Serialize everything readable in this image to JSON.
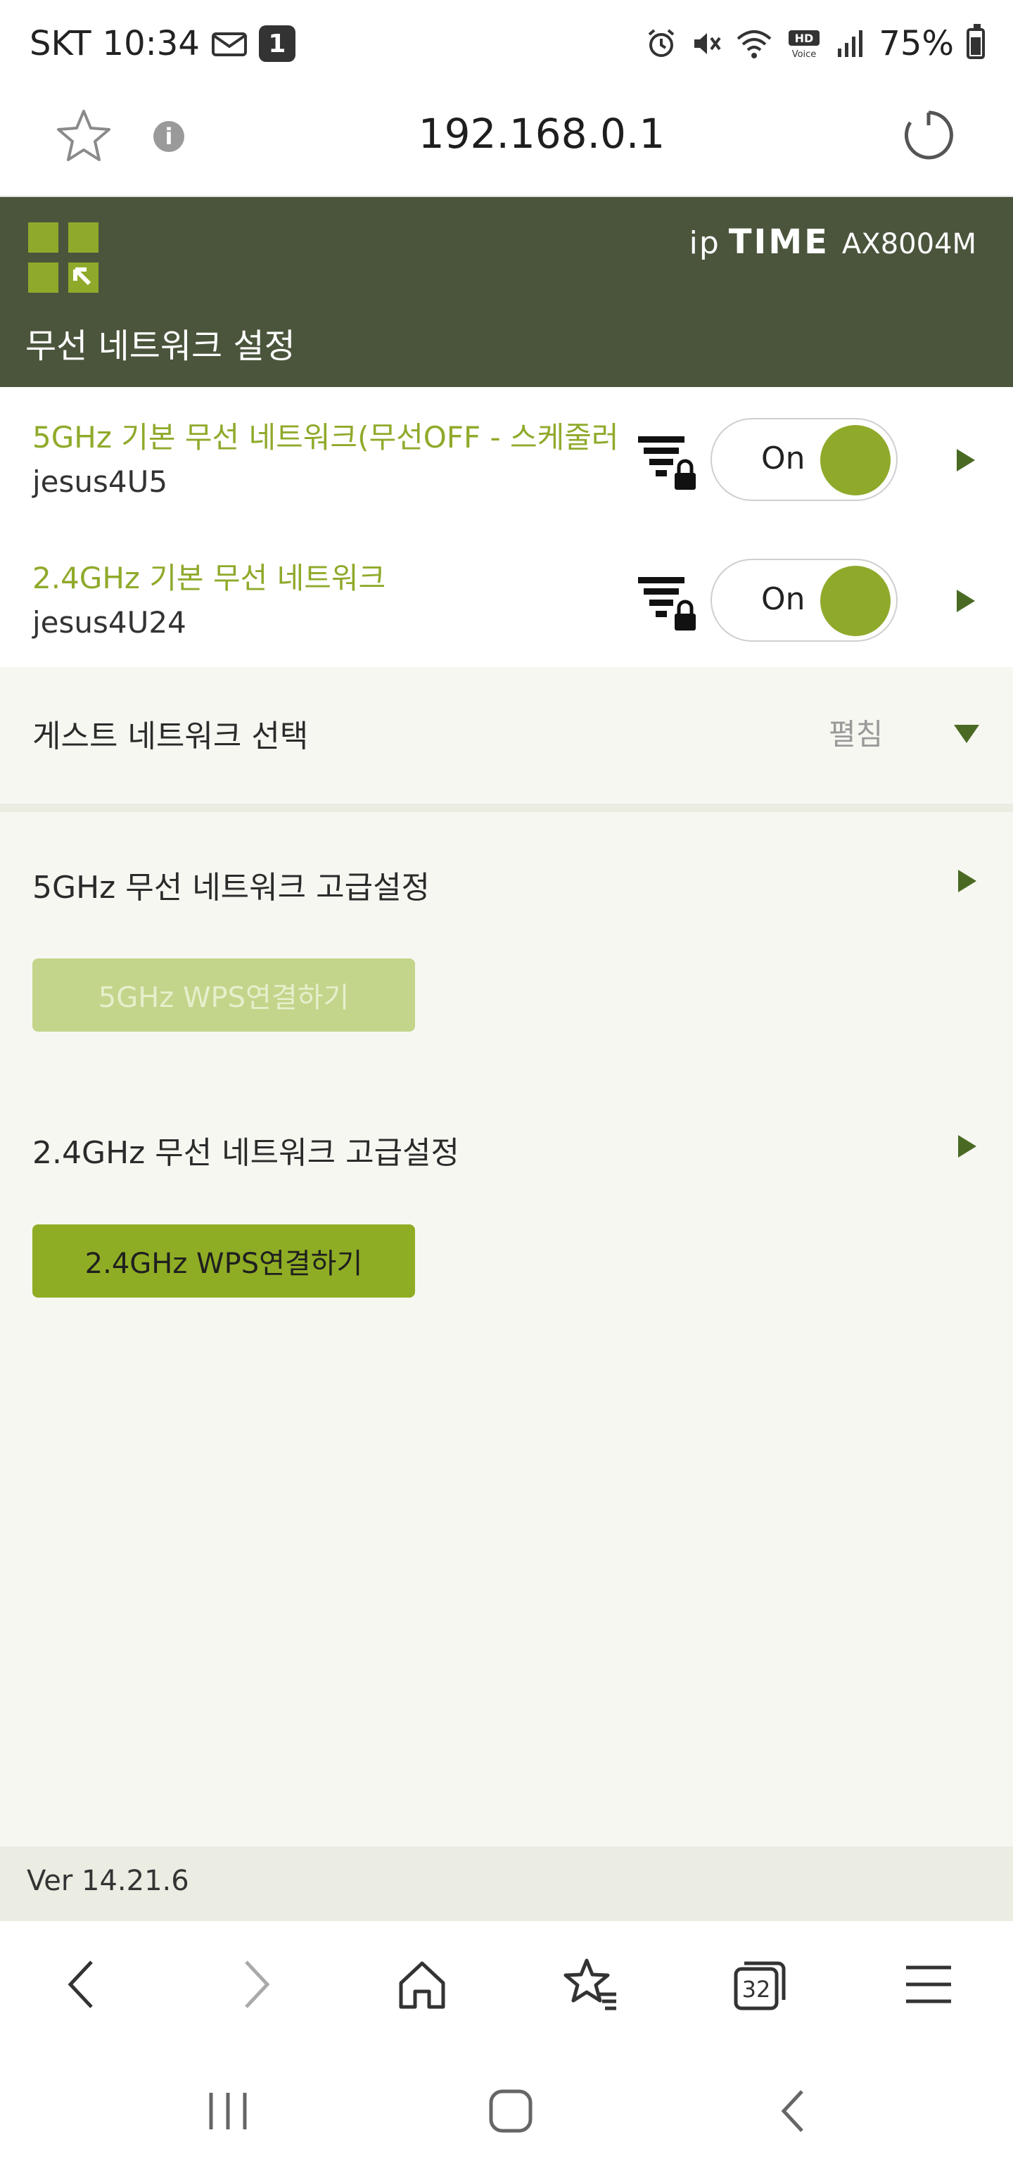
{
  "status_bar": {
    "carrier": "SKT",
    "time": "10:34",
    "notification_count": "1",
    "battery": "75%"
  },
  "url_bar": {
    "url": "192.168.0.1"
  },
  "header": {
    "brand_ip": "ip",
    "brand_time": "TIME",
    "model": "AX8004M",
    "title": "무선 네트워크 설정"
  },
  "networks": [
    {
      "title": "5GHz 기본 무선 네트워크(무선OFF - 스케줄러",
      "ssid": "jesus4U5",
      "toggle": "On"
    },
    {
      "title": "2.4GHz 기본 무선 네트워크",
      "ssid": "jesus4U24",
      "toggle": "On"
    }
  ],
  "guest": {
    "label": "게스트 네트워크 선택",
    "expand_label": "펼침"
  },
  "advanced": [
    {
      "label": "5GHz 무선 네트워크 고급설정",
      "wps_label": "5GHz WPS연결하기"
    },
    {
      "label": "2.4GHz 무선 네트워크 고급설정",
      "wps_label": "2.4GHz WPS연결하기"
    }
  ],
  "footer": {
    "version": "Ver 14.21.6"
  },
  "browser_toolbar": {
    "tabs_count": "32"
  },
  "colors": {
    "accent": "#8faa2b",
    "header_bg": "#4a553c",
    "arrow": "#4a6a23"
  }
}
